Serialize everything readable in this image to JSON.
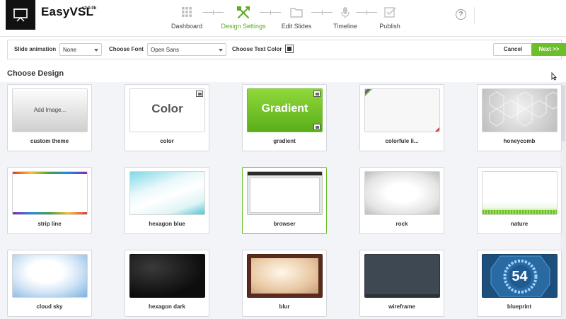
{
  "app": {
    "name": "EasyVSL",
    "version": "v2.0.0b",
    "logo_icon": "presentation-board-icon"
  },
  "steps": [
    {
      "label": "Dashboard",
      "icon": "grid-icon",
      "active": false
    },
    {
      "label": "Design Settings",
      "icon": "design-tools-icon",
      "active": true
    },
    {
      "label": "Edit Slides",
      "icon": "folder-icon",
      "active": false
    },
    {
      "label": "Timeline",
      "icon": "microphone-icon",
      "active": false
    },
    {
      "label": "Publish",
      "icon": "checkbox-icon",
      "active": false
    }
  ],
  "help_icon": "?",
  "toolbar": {
    "slide_animation_label": "Slide animation",
    "slide_animation_value": "None",
    "font_label": "Choose Font",
    "font_value": "Open Sans",
    "text_color_label": "Choose Text Color",
    "text_color_value": "#333333",
    "cancel_label": "Cancel",
    "next_label": "Next  >>"
  },
  "colors": {
    "accent": "#6bbf2a",
    "active_step": "#5aa91e"
  },
  "section_title": "Choose Design",
  "designs": [
    {
      "name": "custom theme",
      "thumb_text": "Add Image...",
      "selected": false
    },
    {
      "name": "color",
      "thumb_text": "Color",
      "selected": false
    },
    {
      "name": "gradient",
      "thumb_text": "Gradient",
      "selected": false
    },
    {
      "name": "colorfule li...",
      "thumb_text": "",
      "selected": false
    },
    {
      "name": "honeycomb",
      "thumb_text": "",
      "selected": false
    },
    {
      "name": "strip line",
      "thumb_text": "",
      "selected": false
    },
    {
      "name": "hexagon blue",
      "thumb_text": "",
      "selected": false
    },
    {
      "name": "browser",
      "thumb_text": "",
      "selected": true
    },
    {
      "name": "rock",
      "thumb_text": "",
      "selected": false
    },
    {
      "name": "nature",
      "thumb_text": "",
      "selected": false
    },
    {
      "name": "cloud sky",
      "thumb_text": "",
      "selected": false
    },
    {
      "name": "hexagon dark",
      "thumb_text": "",
      "selected": false
    },
    {
      "name": "blur",
      "thumb_text": "",
      "selected": false
    },
    {
      "name": "wireframe",
      "thumb_text": "",
      "selected": false
    },
    {
      "name": "blueprint",
      "thumb_text": "54",
      "selected": false
    }
  ]
}
